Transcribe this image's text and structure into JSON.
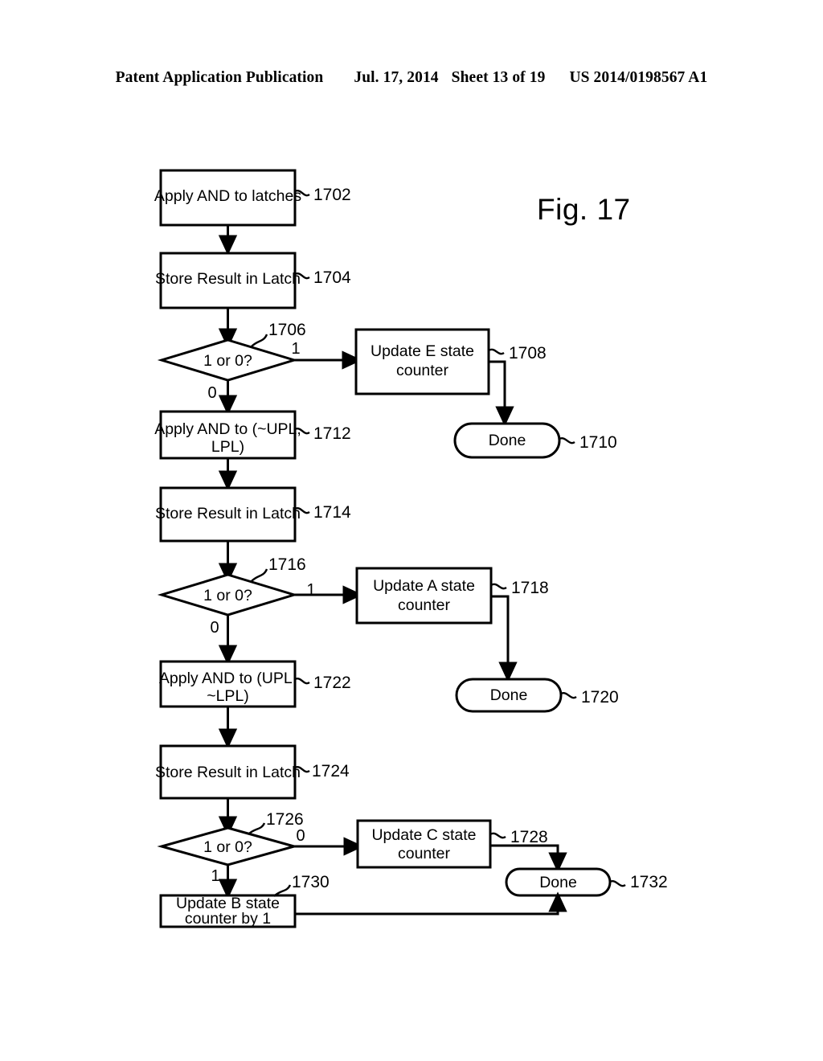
{
  "header": {
    "publication": "Patent Application Publication",
    "date": "Jul. 17, 2014",
    "sheet": "Sheet 13 of 19",
    "patent_number": "US 2014/0198567 A1"
  },
  "figure": {
    "title": "Fig. 17"
  },
  "nodes": {
    "n1702": {
      "label": "Apply AND to latches",
      "ref": "1702"
    },
    "n1704": {
      "label": "Store Result in Latch",
      "ref": "1704"
    },
    "n1706": {
      "label": "1 or 0?",
      "ref": "1706",
      "branch_right": "1",
      "branch_down": "0"
    },
    "n1708": {
      "label_line1": "Update E state",
      "label_line2": "counter",
      "ref": "1708"
    },
    "n1710": {
      "label": "Done",
      "ref": "1710"
    },
    "n1712": {
      "label_line1": "Apply AND to (~UPL,",
      "label_line2": "LPL)",
      "ref": "1712"
    },
    "n1714": {
      "label": "Store Result in Latch",
      "ref": "1714"
    },
    "n1716": {
      "label": "1 or 0?",
      "ref": "1716",
      "branch_right": "1",
      "branch_down": "0"
    },
    "n1718": {
      "label_line1": "Update A state",
      "label_line2": "counter",
      "ref": "1718"
    },
    "n1720": {
      "label": "Done",
      "ref": "1720"
    },
    "n1722": {
      "label_line1": "Apply AND to (UPL,",
      "label_line2": "~LPL)",
      "ref": "1722"
    },
    "n1724": {
      "label": "Store Result in Latch",
      "ref": "1724"
    },
    "n1726": {
      "label": "1 or 0?",
      "ref": "1726",
      "branch_right": "0",
      "branch_down": "1"
    },
    "n1728": {
      "label_line1": "Update C state",
      "label_line2": "counter",
      "ref": "1728"
    },
    "n1730": {
      "label_line1": "Update B state",
      "label_line2": "counter by 1",
      "ref": "1730"
    },
    "n1732": {
      "label": "Done",
      "ref": "1732"
    }
  },
  "colors": {
    "ink": "#000000",
    "paper": "#ffffff"
  }
}
